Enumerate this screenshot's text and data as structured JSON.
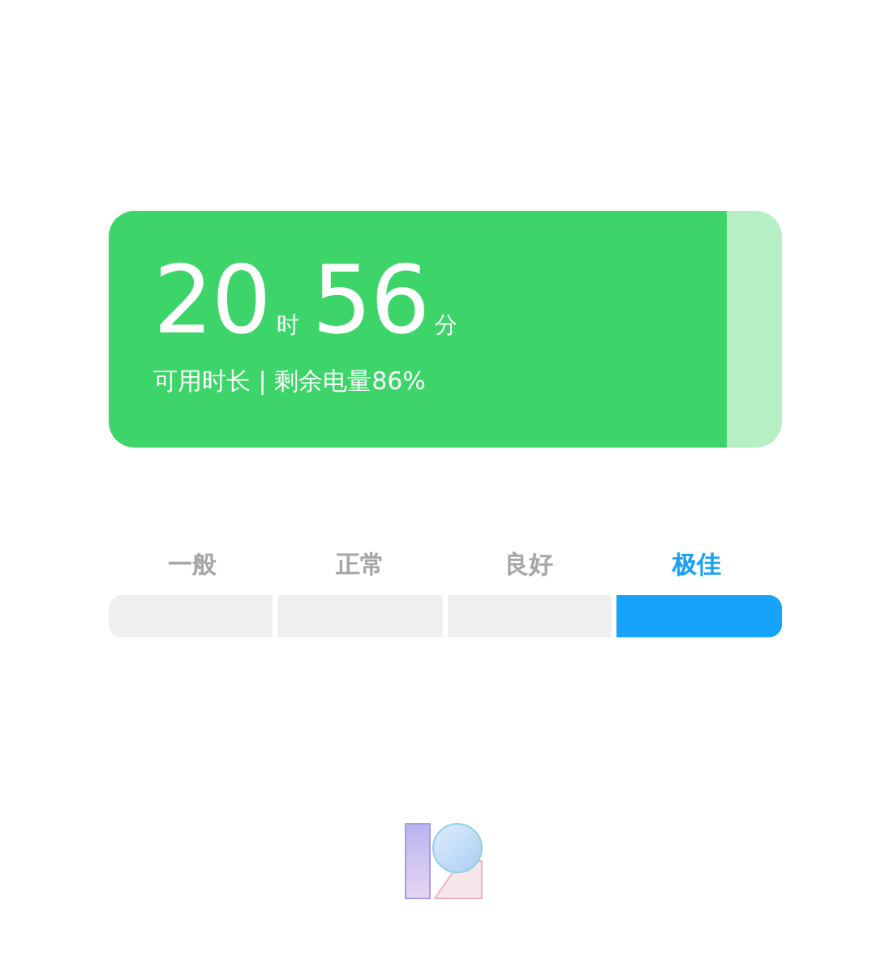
{
  "battery_card": {
    "hours": "20",
    "hours_unit": "时",
    "minutes": "56",
    "minutes_unit": "分",
    "caption": "可用时长 | 剩余电量86%",
    "level": 0.92
  },
  "rating": [
    {
      "label": "一般",
      "selected": false
    },
    {
      "label": "正常",
      "selected": false
    },
    {
      "label": "良好",
      "selected": false
    },
    {
      "label": "极佳",
      "selected": true
    }
  ]
}
